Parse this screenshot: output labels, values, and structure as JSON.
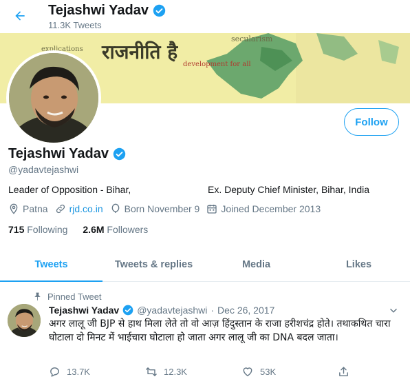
{
  "colors": {
    "accent": "#1da1f2",
    "verified": "#1da1f2",
    "muted": "#657786",
    "text": "#14171a"
  },
  "header": {
    "name": "Tejashwi Yadav",
    "tweet_count": "11.3K Tweets",
    "back_icon": "arrow-left-icon"
  },
  "banner": {
    "hindi_text": "राजनीति है",
    "words": [
      "secularism",
      "development for all",
      "explications"
    ]
  },
  "profile": {
    "name": "Tejashwi Yadav",
    "handle": "@yadavtejashwi",
    "follow_label": "Follow",
    "bio_left": "Leader of Opposition - Bihar,",
    "bio_right": "Ex. Deputy Chief Minister, Bihar, India",
    "location": "Patna",
    "website": "rjd.co.in",
    "birthday": "Born November 9",
    "joined": "Joined December 2013",
    "following_count": "715",
    "following_label": "Following",
    "followers_count": "2.6M",
    "followers_label": "Followers"
  },
  "tabs": [
    {
      "label": "Tweets",
      "active": true
    },
    {
      "label": "Tweets & replies",
      "active": false
    },
    {
      "label": "Media",
      "active": false
    },
    {
      "label": "Likes",
      "active": false
    }
  ],
  "tweet": {
    "pinned_label": "Pinned Tweet",
    "author_name": "Tejashwi Yadav",
    "author_handle": "@yadavtejashwi",
    "separator": "·",
    "date": "Dec 26, 2017",
    "text": "अगर लालू जी BJP से हाथ मिला लेते तो वो आज़ हिंदुस्तान के राजा हरीशचंद्र होते। तथाकथित चारा घोटाला दो मिनट में भाईचारा घोटाला हो जाता अगर लालू जी का DNA बदल जाता।",
    "replies": "13.7K",
    "retweets": "12.3K",
    "likes": "53K"
  }
}
